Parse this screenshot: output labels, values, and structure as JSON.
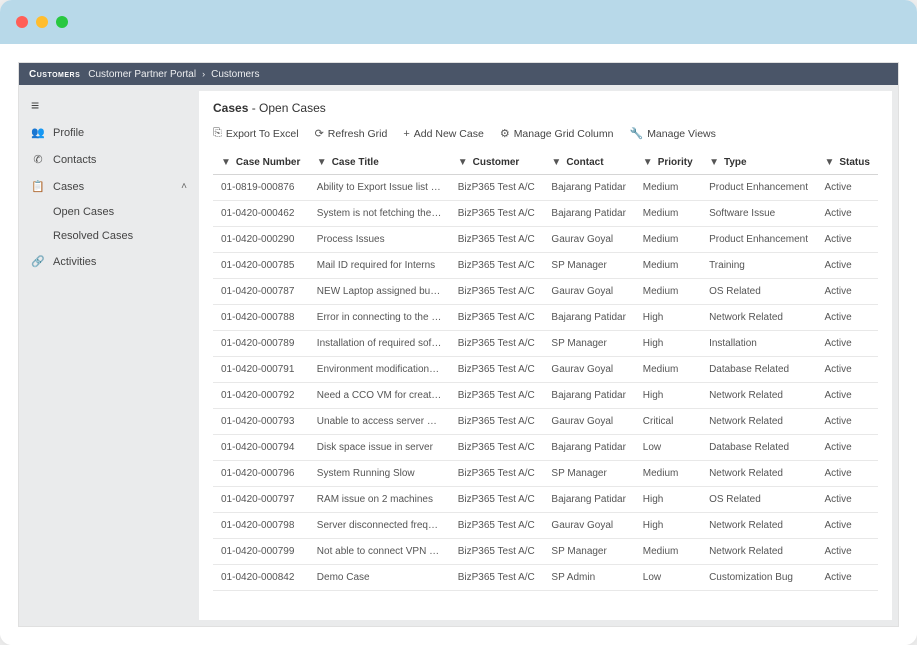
{
  "topbar": {
    "brand": "Customers",
    "breadcrumb1": "Customer Partner Portal",
    "breadcrumb2": "Customers"
  },
  "sidebar": {
    "items": {
      "profile": {
        "label": "Profile"
      },
      "contacts": {
        "label": "Contacts"
      },
      "cases": {
        "label": "Cases"
      },
      "open_cases": {
        "label": "Open Cases"
      },
      "resolved_cases": {
        "label": "Resolved Cases"
      },
      "activities": {
        "label": "Activities"
      }
    }
  },
  "page": {
    "title_main": "Cases",
    "title_sub": " - Open Cases"
  },
  "toolbar": {
    "export_excel": "Export To Excel",
    "refresh_grid": "Refresh Grid",
    "add_new_case": "Add New Case",
    "manage_grid_column": "Manage Grid Column",
    "manage_views": "Manage Views"
  },
  "grid": {
    "columns": {
      "case_number": "Case Number",
      "case_title": "Case Title",
      "customer": "Customer",
      "contact": "Contact",
      "priority": "Priority",
      "type": "Type",
      "status": "Status"
    },
    "rows": [
      {
        "case_number": "01-0819-000876",
        "case_title": "Ability to Export Issue list filte...",
        "customer": "BizP365 Test A/C",
        "contact": "Bajarang Patidar",
        "priority": "Medium",
        "type": "Product Enhancement",
        "status": "Active"
      },
      {
        "case_number": "01-0420-000462",
        "case_title": "System is not fetching the alr...",
        "customer": "BizP365 Test A/C",
        "contact": "Bajarang Patidar",
        "priority": "Medium",
        "type": "Software Issue",
        "status": "Active"
      },
      {
        "case_number": "01-0420-000290",
        "case_title": "Process Issues",
        "customer": "BizP365 Test A/C",
        "contact": "Gaurav Goyal",
        "priority": "Medium",
        "type": "Product Enhancement",
        "status": "Active"
      },
      {
        "case_number": "01-0420-000785",
        "case_title": "Mail ID required for Interns",
        "customer": "BizP365 Test A/C",
        "contact": "SP Manager",
        "priority": "Medium",
        "type": "Training",
        "status": "Active"
      },
      {
        "case_number": "01-0420-000787",
        "case_title": "NEW Laptop assigned but O...",
        "customer": "BizP365 Test A/C",
        "contact": "Gaurav Goyal",
        "priority": "Medium",
        "type": "OS Related",
        "status": "Active"
      },
      {
        "case_number": "01-0420-000788",
        "case_title": "Error in connecting to the ser...",
        "customer": "BizP365 Test A/C",
        "contact": "Bajarang Patidar",
        "priority": "High",
        "type": "Network Related",
        "status": "Active"
      },
      {
        "case_number": "01-0420-000789",
        "case_title": "Installation of required softwa...",
        "customer": "BizP365 Test A/C",
        "contact": "SP Manager",
        "priority": "High",
        "type": "Installation",
        "status": "Active"
      },
      {
        "case_number": "01-0420-000791",
        "case_title": "Environment modification req...",
        "customer": "BizP365 Test A/C",
        "contact": "Gaurav Goyal",
        "priority": "Medium",
        "type": "Database Related",
        "status": "Active"
      },
      {
        "case_number": "01-0420-000792",
        "case_title": "Need a CCO VM for creating ...",
        "customer": "BizP365 Test A/C",
        "contact": "Bajarang Patidar",
        "priority": "High",
        "type": "Network Related",
        "status": "Active"
      },
      {
        "case_number": "01-0420-000793",
        "case_title": "Unable to access server shar...",
        "customer": "BizP365 Test A/C",
        "contact": "Gaurav Goyal",
        "priority": "Critical",
        "type": "Network Related",
        "status": "Active"
      },
      {
        "case_number": "01-0420-000794",
        "case_title": "Disk space issue in server",
        "customer": "BizP365 Test A/C",
        "contact": "Bajarang Patidar",
        "priority": "Low",
        "type": "Database Related",
        "status": "Active"
      },
      {
        "case_number": "01-0420-000796",
        "case_title": "System Running Slow",
        "customer": "BizP365 Test A/C",
        "contact": "SP Manager",
        "priority": "Medium",
        "type": "Network Related",
        "status": "Active"
      },
      {
        "case_number": "01-0420-000797",
        "case_title": "RAM issue on 2 machines",
        "customer": "BizP365 Test A/C",
        "contact": "Bajarang Patidar",
        "priority": "High",
        "type": "OS Related",
        "status": "Active"
      },
      {
        "case_number": "01-0420-000798",
        "case_title": "Server disconnected frequently",
        "customer": "BizP365 Test A/C",
        "contact": "Gaurav Goyal",
        "priority": "High",
        "type": "Network Related",
        "status": "Active"
      },
      {
        "case_number": "01-0420-000799",
        "case_title": "Not able to connect VPN ser...",
        "customer": "BizP365 Test A/C",
        "contact": "SP Manager",
        "priority": "Medium",
        "type": "Network Related",
        "status": "Active"
      },
      {
        "case_number": "01-0420-000842",
        "case_title": "Demo Case",
        "customer": "BizP365 Test A/C",
        "contact": "SP Admin",
        "priority": "Low",
        "type": "Customization Bug",
        "status": "Active"
      }
    ]
  }
}
